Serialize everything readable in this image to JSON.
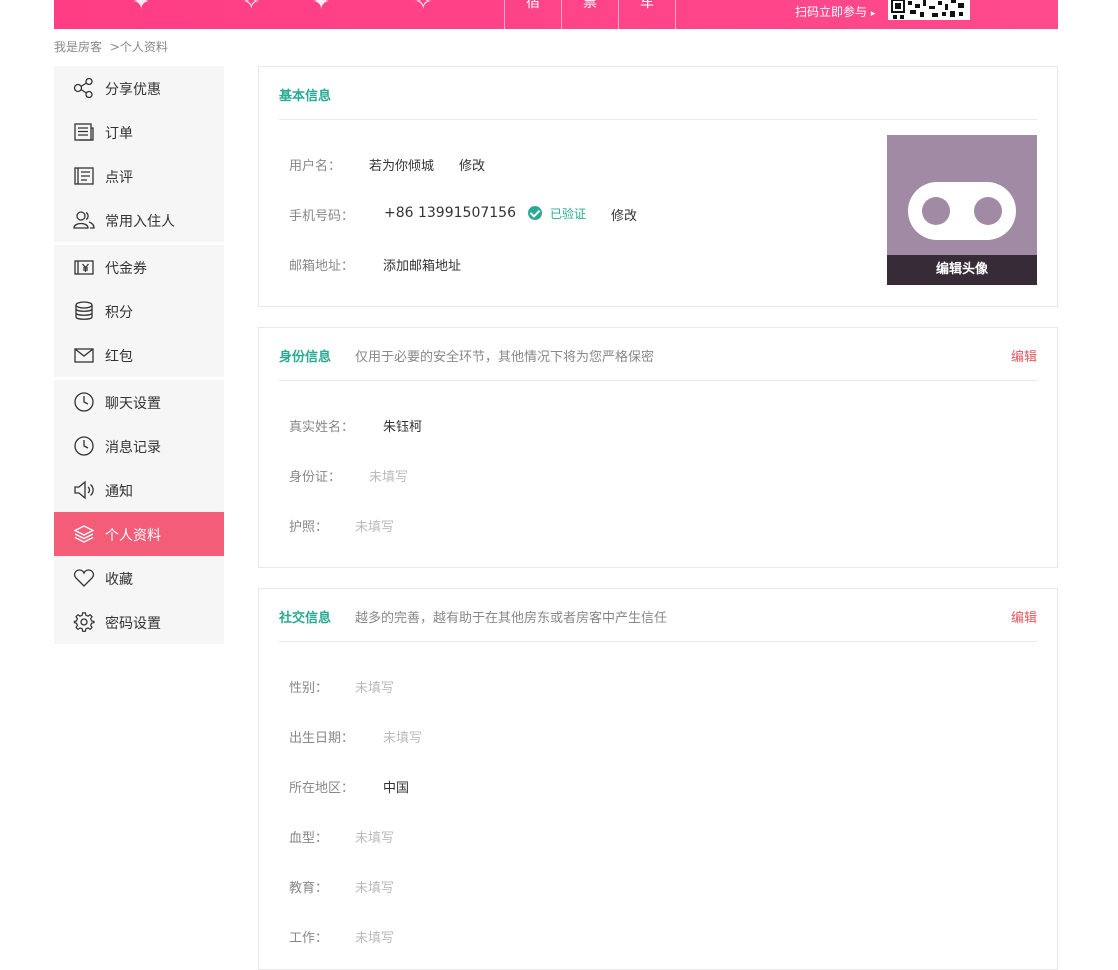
{
  "banner": {
    "tabs": [
      "宿",
      "票",
      "车"
    ],
    "scan_text": "扫码立即参与",
    "scan_arrow": "▸"
  },
  "breadcrumb": {
    "root": "我是房客",
    "sep": ">",
    "current": "个人资料"
  },
  "sidebar": {
    "groups": [
      [
        {
          "label": "分享优惠",
          "icon": "share-icon"
        },
        {
          "label": "订单",
          "icon": "order-icon"
        },
        {
          "label": "点评",
          "icon": "review-icon"
        },
        {
          "label": "常用入住人",
          "icon": "guests-icon"
        }
      ],
      [
        {
          "label": "代金券",
          "icon": "coupon-icon"
        },
        {
          "label": "积分",
          "icon": "points-icon"
        },
        {
          "label": "红包",
          "icon": "red-envelope-icon"
        }
      ],
      [
        {
          "label": "聊天设置",
          "icon": "clock-icon"
        },
        {
          "label": "消息记录",
          "icon": "clock-icon"
        },
        {
          "label": "通知",
          "icon": "speaker-icon"
        },
        {
          "label": "个人资料",
          "icon": "layers-icon",
          "active": true
        },
        {
          "label": "收藏",
          "icon": "heart-icon"
        },
        {
          "label": "密码设置",
          "icon": "gear-icon"
        }
      ]
    ]
  },
  "basic": {
    "title": "基本信息",
    "username_label": "用户名：",
    "username": "若为你倾城",
    "username_edit": "修改",
    "phone_label": "手机号码：",
    "phone": "+86 13991507156",
    "verified": "已验证",
    "phone_edit": "修改",
    "email_label": "邮箱地址：",
    "email_add": "添加邮箱地址",
    "avatar_edit": "编辑头像"
  },
  "identity": {
    "title": "身份信息",
    "desc": "仅用于必要的安全环节，其他情况下将为您严格保密",
    "edit": "编辑",
    "realname_label": "真实姓名：",
    "realname": "朱钰柯",
    "idcard_label": "身份证：",
    "idcard": "未填写",
    "passport_label": "护照：",
    "passport": "未填写"
  },
  "social": {
    "title": "社交信息",
    "desc": "越多的完善，越有助于在其他房东或者房客中产生信任",
    "edit": "编辑",
    "gender_label": "性别：",
    "gender": "未填写",
    "birthday_label": "出生日期：",
    "birthday": "未填写",
    "region_label": "所在地区：",
    "region": "中国",
    "blood_label": "血型：",
    "blood": "未填写",
    "education_label": "教育：",
    "education": "未填写",
    "work_label": "工作：",
    "work": "未填写"
  },
  "colors": {
    "brand_pink": "#ff3d84",
    "active_item": "#f35d78",
    "accent_green": "#2aaa93",
    "link_red": "#e4575e"
  }
}
